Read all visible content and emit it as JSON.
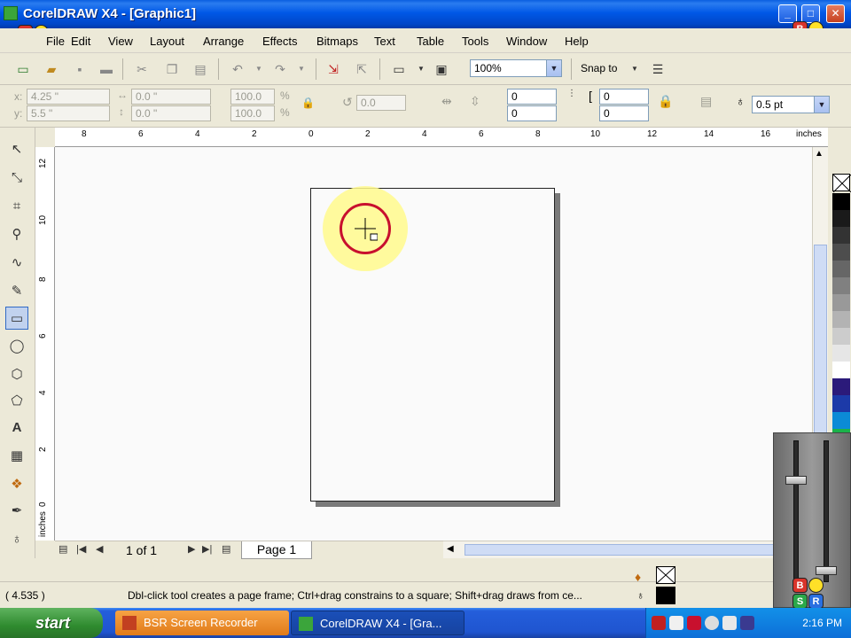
{
  "window": {
    "title": "CorelDRAW X4 - [Graphic1]",
    "min_label": "_",
    "max_label": "□",
    "close_label": "✕"
  },
  "menu": [
    "File",
    "Edit",
    "View",
    "Layout",
    "Arrange",
    "Effects",
    "Bitmaps",
    "Text",
    "Table",
    "Tools",
    "Window",
    "Help"
  ],
  "toolbar": {
    "zoom": "100%",
    "snap_to": "Snap to"
  },
  "propbar": {
    "x_label": "x:",
    "x_value": "4.25 \"",
    "y_label": "y:",
    "y_value": "5.5 \"",
    "w_value": "0.0 \"",
    "h_value": "0.0 \"",
    "scale_x": "100.0",
    "scale_y": "100.0",
    "pct": "%",
    "rotation": "0.0",
    "corner_tl": "0",
    "corner_bl": "0",
    "corner_tr": "0",
    "corner_br": "0",
    "outline_width": "0.5 pt"
  },
  "rulers": {
    "h_labels": [
      "8",
      "6",
      "4",
      "2",
      "0",
      "2",
      "4",
      "6",
      "8",
      "10",
      "12",
      "14",
      "16"
    ],
    "h_unit": "inches",
    "v_labels": [
      "12",
      "10",
      "8",
      "6",
      "4",
      "2",
      "0"
    ],
    "v_unit": "inches"
  },
  "pagenav": {
    "counter": "1 of 1",
    "tab": "Page 1"
  },
  "status": {
    "coords": "( 4.535 )",
    "hint": "Dbl-click tool creates a page frame; Ctrl+drag constrains to a square; Shift+drag draws from ce..."
  },
  "taskbar": {
    "start": "start",
    "tasks": [
      "BSR Screen Recorder",
      "CorelDRAW X4 - [Gra..."
    ],
    "clock": "2:16 PM"
  },
  "badges": {
    "red": "B",
    "yellow": "",
    "green": "S",
    "blue": "R"
  },
  "colors": {
    "title_bar": "#0058e6",
    "highlight": "#fff98c",
    "ring": "#c8102e",
    "taskbar": "#245edb",
    "start": "#2f8b2f"
  },
  "palette": [
    "#000000",
    "#1a1a1a",
    "#333333",
    "#4d4d4d",
    "#666666",
    "#808080",
    "#999999",
    "#b3b3b3",
    "#cccccc",
    "#e6e6e6",
    "#ffffff",
    "#2b1a7a",
    "#1c3aa8",
    "#0b8bd6",
    "#1bb34a"
  ],
  "icons": {
    "pick": "pick-tool-icon",
    "shape": "shape-tool-icon",
    "crop": "crop-tool-icon",
    "zoom": "zoom-tool-icon",
    "freehand": "freehand-tool-icon",
    "smart_fill": "smart-fill-tool-icon",
    "rectangle": "rectangle-tool-icon",
    "ellipse": "ellipse-tool-icon",
    "polygon": "polygon-tool-icon",
    "basic_shapes": "basic-shapes-tool-icon",
    "text": "text-tool-icon",
    "table": "table-tool-icon",
    "interactive": "interactive-tool-icon",
    "eyedropper": "eyedropper-tool-icon",
    "outline": "outline-tool-icon"
  }
}
